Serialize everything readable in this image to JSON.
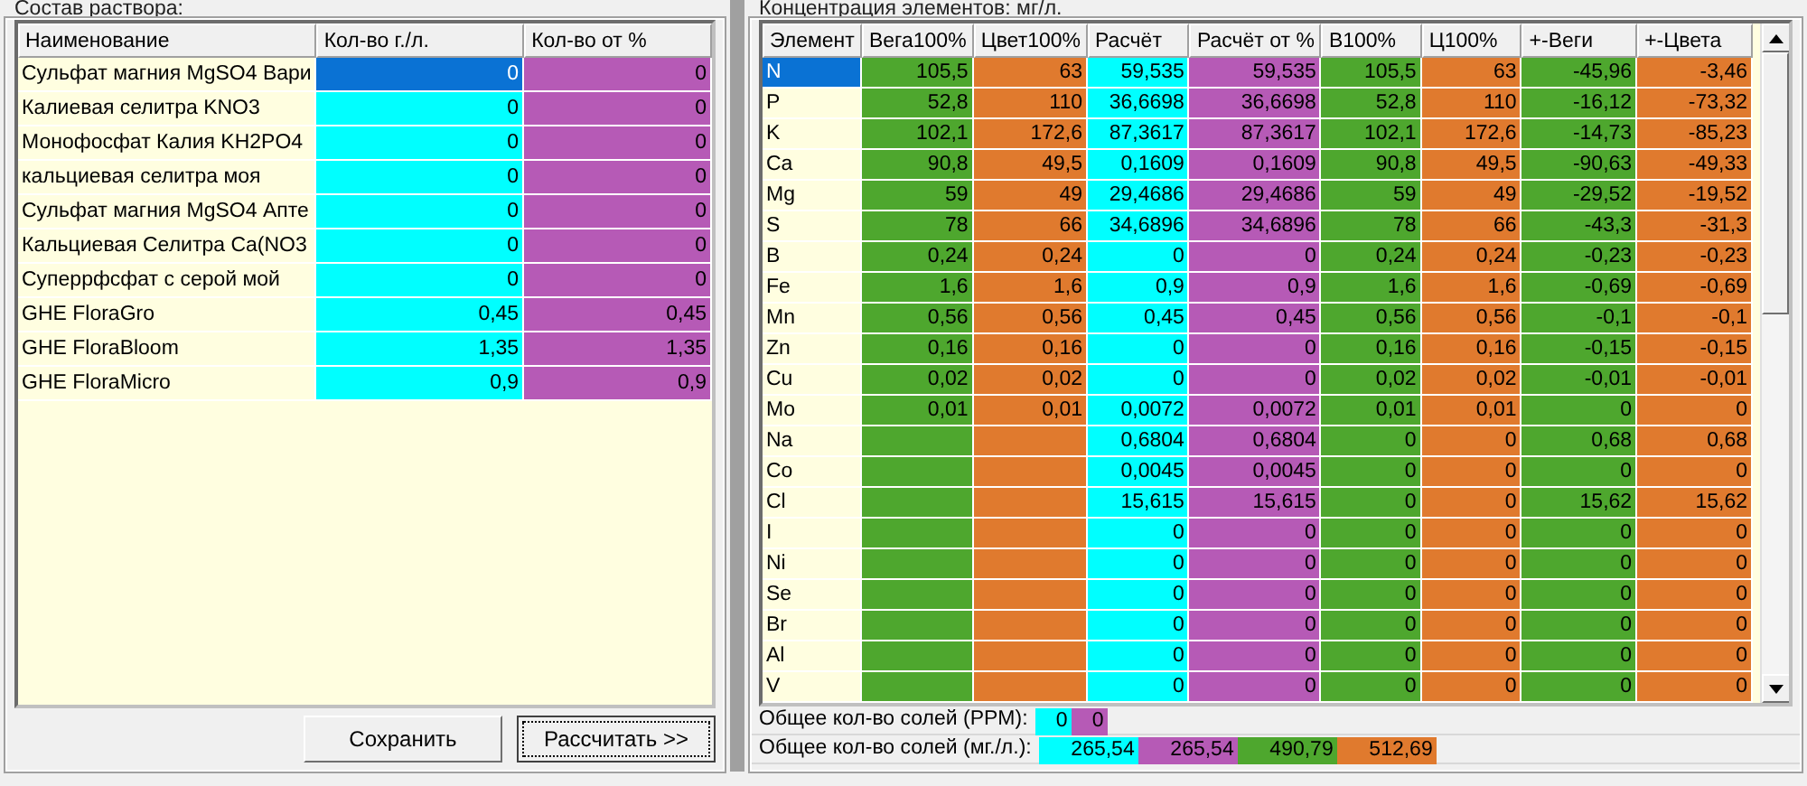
{
  "left_panel": {
    "title": "Состав раствора:",
    "columns": [
      {
        "label": "Наименование",
        "color": "#fffee0"
      },
      {
        "label": "Кол-во г./л.",
        "color": "#00ffff"
      },
      {
        "label": "Кол-во от %",
        "color": "#b65ab6"
      }
    ],
    "rows": [
      {
        "name": "Сульфат магния MgSO4 Вари",
        "g_per_l": "0",
        "percent": "0",
        "selected": true
      },
      {
        "name": "Калиевая селитра KNO3",
        "g_per_l": "0",
        "percent": "0",
        "selected": false
      },
      {
        "name": "Монофосфат Калия KH2PO4",
        "g_per_l": "0",
        "percent": "0",
        "selected": false
      },
      {
        "name": "кальциевая селитра моя",
        "g_per_l": "0",
        "percent": "0",
        "selected": false
      },
      {
        "name": "Сульфат магния MgSO4 Апте",
        "g_per_l": "0",
        "percent": "0",
        "selected": false
      },
      {
        "name": "Кальциевая Селитра Ca(NO3",
        "g_per_l": "0",
        "percent": "0",
        "selected": false
      },
      {
        "name": "Суперрфсфат с серой мой",
        "g_per_l": "0",
        "percent": "0",
        "selected": false
      },
      {
        "name": "GHE FloraGro",
        "g_per_l": "0,45",
        "percent": "0,45",
        "selected": false
      },
      {
        "name": "GHE FloraBloom",
        "g_per_l": "1,35",
        "percent": "1,35",
        "selected": false
      },
      {
        "name": "GHE FloraMicro",
        "g_per_l": "0,9",
        "percent": "0,9",
        "selected": false
      }
    ],
    "buttons": [
      {
        "label": "Сохранить",
        "focused": false
      },
      {
        "label": "Рассчитать >>",
        "focused": true
      }
    ]
  },
  "right_panel": {
    "title": "Концентрация элементов: мг/л.",
    "columns": [
      {
        "label": "Элемент",
        "color": "#fffee0"
      },
      {
        "label": "Вега100%",
        "color": "#4ea72e"
      },
      {
        "label": "Цвет100%",
        "color": "#e07a2e"
      },
      {
        "label": "Расчёт",
        "color": "#00ffff"
      },
      {
        "label": "Расчёт от %",
        "color": "#b65ab6"
      },
      {
        "label": "В100%",
        "color": "#4ea72e"
      },
      {
        "label": "Ц100%",
        "color": "#e07a2e"
      },
      {
        "label": "+-Веги",
        "color": "#4ea72e"
      },
      {
        "label": "+-Цвета",
        "color": "#e07a2e"
      }
    ],
    "rows": [
      {
        "element": "N",
        "selected": true,
        "vega_100": "105,5",
        "cvet_100": "63",
        "calc": "59,535",
        "calc_pct": "59,535",
        "b_100": "105,5",
        "c_100": "63",
        "diff_vega": "-45,96",
        "diff_cvet": "-3,46"
      },
      {
        "element": "P",
        "selected": false,
        "vega_100": "52,8",
        "cvet_100": "110",
        "calc": "36,6698",
        "calc_pct": "36,6698",
        "b_100": "52,8",
        "c_100": "110",
        "diff_vega": "-16,12",
        "diff_cvet": "-73,32"
      },
      {
        "element": "K",
        "selected": false,
        "vega_100": "102,1",
        "cvet_100": "172,6",
        "calc": "87,3617",
        "calc_pct": "87,3617",
        "b_100": "102,1",
        "c_100": "172,6",
        "diff_vega": "-14,73",
        "diff_cvet": "-85,23"
      },
      {
        "element": "Ca",
        "selected": false,
        "vega_100": "90,8",
        "cvet_100": "49,5",
        "calc": "0,1609",
        "calc_pct": "0,1609",
        "b_100": "90,8",
        "c_100": "49,5",
        "diff_vega": "-90,63",
        "diff_cvet": "-49,33"
      },
      {
        "element": "Mg",
        "selected": false,
        "vega_100": "59",
        "cvet_100": "49",
        "calc": "29,4686",
        "calc_pct": "29,4686",
        "b_100": "59",
        "c_100": "49",
        "diff_vega": "-29,52",
        "diff_cvet": "-19,52"
      },
      {
        "element": "S",
        "selected": false,
        "vega_100": "78",
        "cvet_100": "66",
        "calc": "34,6896",
        "calc_pct": "34,6896",
        "b_100": "78",
        "c_100": "66",
        "diff_vega": "-43,3",
        "diff_cvet": "-31,3"
      },
      {
        "element": "B",
        "selected": false,
        "vega_100": "0,24",
        "cvet_100": "0,24",
        "calc": "0",
        "calc_pct": "0",
        "b_100": "0,24",
        "c_100": "0,24",
        "diff_vega": "-0,23",
        "diff_cvet": "-0,23"
      },
      {
        "element": "Fe",
        "selected": false,
        "vega_100": "1,6",
        "cvet_100": "1,6",
        "calc": "0,9",
        "calc_pct": "0,9",
        "b_100": "1,6",
        "c_100": "1,6",
        "diff_vega": "-0,69",
        "diff_cvet": "-0,69"
      },
      {
        "element": "Mn",
        "selected": false,
        "vega_100": "0,56",
        "cvet_100": "0,56",
        "calc": "0,45",
        "calc_pct": "0,45",
        "b_100": "0,56",
        "c_100": "0,56",
        "diff_vega": "-0,1",
        "diff_cvet": "-0,1"
      },
      {
        "element": "Zn",
        "selected": false,
        "vega_100": "0,16",
        "cvet_100": "0,16",
        "calc": "0",
        "calc_pct": "0",
        "b_100": "0,16",
        "c_100": "0,16",
        "diff_vega": "-0,15",
        "diff_cvet": "-0,15"
      },
      {
        "element": "Cu",
        "selected": false,
        "vega_100": "0,02",
        "cvet_100": "0,02",
        "calc": "0",
        "calc_pct": "0",
        "b_100": "0,02",
        "c_100": "0,02",
        "diff_vega": "-0,01",
        "diff_cvet": "-0,01"
      },
      {
        "element": "Mo",
        "selected": false,
        "vega_100": "0,01",
        "cvet_100": "0,01",
        "calc": "0,0072",
        "calc_pct": "0,0072",
        "b_100": "0,01",
        "c_100": "0,01",
        "diff_vega": "0",
        "diff_cvet": "0"
      },
      {
        "element": "Na",
        "selected": false,
        "calc": "0,6804",
        "calc_pct": "0,6804",
        "b_100": "0",
        "c_100": "0",
        "diff_vega": "0,68",
        "diff_cvet": "0,68"
      },
      {
        "element": "Co",
        "selected": false,
        "calc": "0,0045",
        "calc_pct": "0,0045",
        "b_100": "0",
        "c_100": "0",
        "diff_vega": "0",
        "diff_cvet": "0"
      },
      {
        "element": "Cl",
        "selected": false,
        "calc": "15,615",
        "calc_pct": "15,615",
        "b_100": "0",
        "c_100": "0",
        "diff_vega": "15,62",
        "diff_cvet": "15,62"
      },
      {
        "element": "I",
        "selected": false,
        "calc": "0",
        "calc_pct": "0",
        "b_100": "0",
        "c_100": "0",
        "diff_vega": "0",
        "diff_cvet": "0"
      },
      {
        "element": "Ni",
        "selected": false,
        "calc": "0",
        "calc_pct": "0",
        "b_100": "0",
        "c_100": "0",
        "diff_vega": "0",
        "diff_cvet": "0"
      },
      {
        "element": "Se",
        "selected": false,
        "calc": "0",
        "calc_pct": "0",
        "b_100": "0",
        "c_100": "0",
        "diff_vega": "0",
        "diff_cvet": "0"
      },
      {
        "element": "Br",
        "selected": false,
        "calc": "0",
        "calc_pct": "0",
        "b_100": "0",
        "c_100": "0",
        "diff_vega": "0",
        "diff_cvet": "0"
      },
      {
        "element": "Al",
        "selected": false,
        "calc": "0",
        "calc_pct": "0",
        "b_100": "0",
        "c_100": "0",
        "diff_vega": "0",
        "diff_cvet": "0"
      },
      {
        "element": "V",
        "selected": false,
        "calc": "0",
        "calc_pct": "0",
        "b_100": "0",
        "c_100": "0",
        "diff_vega": "0",
        "diff_cvet": "0"
      }
    ],
    "totals": [
      {
        "label": "Общее кол-во солей (PPM):",
        "values": [
          {
            "text": "0",
            "color": "#00ffff"
          },
          {
            "text": "0",
            "color": "#b65ab6"
          }
        ]
      },
      {
        "label": "Общее кол-во солей (мг./л.):",
        "values": [
          {
            "text": "265,54",
            "color": "#00ffff"
          },
          {
            "text": "265,54",
            "color": "#b65ab6"
          },
          {
            "text": "490,79",
            "color": "#4ea72e"
          },
          {
            "text": "512,69",
            "color": "#e07a2e"
          }
        ]
      }
    ]
  }
}
